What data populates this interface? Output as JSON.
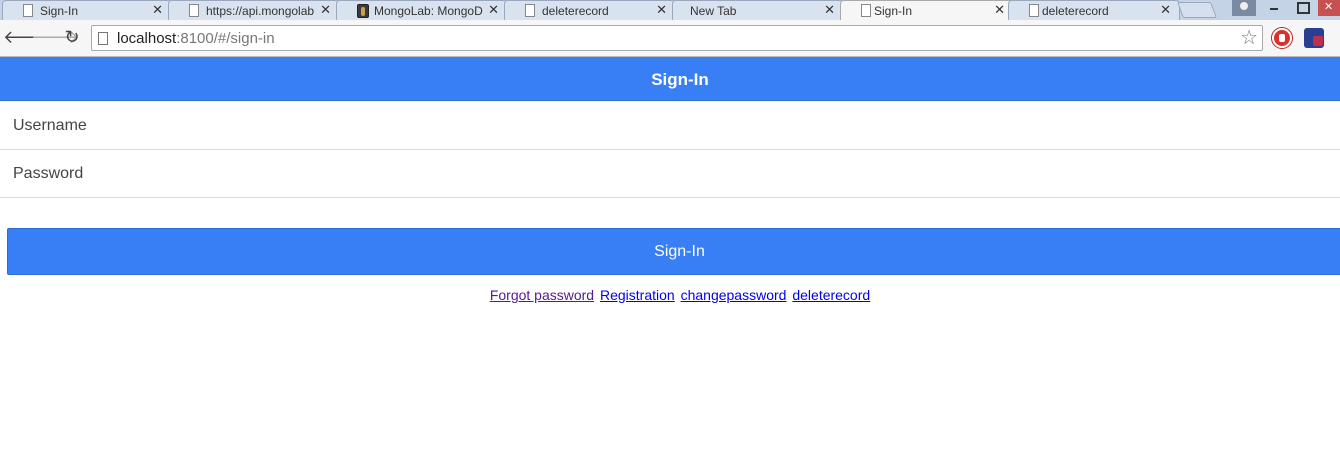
{
  "browser": {
    "tabs": [
      {
        "title": "Sign-In",
        "favicon": "page-icon",
        "active": false
      },
      {
        "title": "https://api.mongolab",
        "favicon": "page-icon",
        "active": false
      },
      {
        "title": "MongoLab: MongoD",
        "favicon": "mongolab-icon",
        "active": false
      },
      {
        "title": "deleterecord",
        "favicon": "page-icon",
        "active": false
      },
      {
        "title": "New Tab",
        "favicon": "none",
        "active": false
      },
      {
        "title": "Sign-In",
        "favicon": "page-icon",
        "active": true
      },
      {
        "title": "deleterecord",
        "favicon": "page-icon",
        "active": false
      }
    ],
    "url_host": "localhost",
    "url_rest": ":8100/#/sign-in"
  },
  "app": {
    "header_title": "Sign-In",
    "username_placeholder": "Username",
    "password_placeholder": "Password",
    "signin_label": "Sign-In",
    "links": [
      {
        "label": "Forgot password",
        "visited": true
      },
      {
        "label": "Registration",
        "visited": false
      },
      {
        "label": "changepassword",
        "visited": false
      },
      {
        "label": "deleterecord",
        "visited": false
      }
    ]
  },
  "colors": {
    "primary": "#387ef5",
    "link_visited": "#551a8b",
    "link": "#0000ee"
  }
}
